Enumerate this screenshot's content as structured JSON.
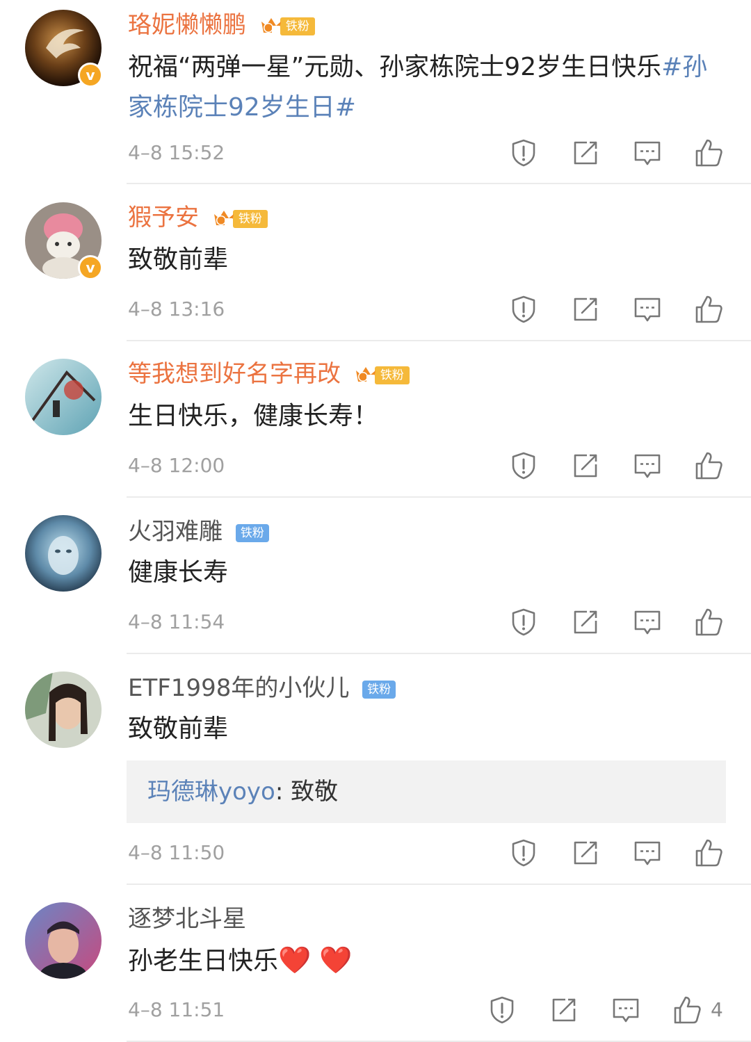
{
  "badges": {
    "fan_label": "铁粉",
    "crown_level_1": "6",
    "crown_level_2": "5",
    "crown_level_3": "6"
  },
  "comments": [
    {
      "username": "珞妮懒懒鹏",
      "text_before": "祝福“两弹一星”元勋、孙家栋院士92岁生日快乐",
      "topic": "#孙家栋院士92岁生日#",
      "time": "4–8 15:52"
    },
    {
      "username": "猳予安",
      "text": "致敬前辈",
      "time": "4–8 13:16"
    },
    {
      "username": "等我想到好名字再改",
      "text": "生日快乐，健康长寿！",
      "time": "4–8 12:00"
    },
    {
      "username": "火羽难雕",
      "text": "健康长寿",
      "time": "4–8 11:54"
    },
    {
      "username": "ETF1998年的小伙儿",
      "text": "致敬前辈",
      "reply_name": "玛德琳yoyo",
      "reply_sep": ": ",
      "reply_text": "致敬",
      "time": "4–8 11:50"
    },
    {
      "username": "逐梦北斗星",
      "text": "孙老生日快乐",
      "hearts": "❤️ ❤️",
      "time": "4–8 11:51",
      "like_count": "4"
    }
  ],
  "colors": {
    "vip_name": "#eb7340",
    "topic": "#5b82b8",
    "fan_badge_gold": "#f5b93a",
    "fan_badge_blue": "#6aa9ea",
    "verified_badge": "#f5a623"
  },
  "icons": [
    "report-icon",
    "repost-icon",
    "comment-icon",
    "like-icon",
    "verified-icon",
    "crown-icon",
    "heart-icon"
  ]
}
